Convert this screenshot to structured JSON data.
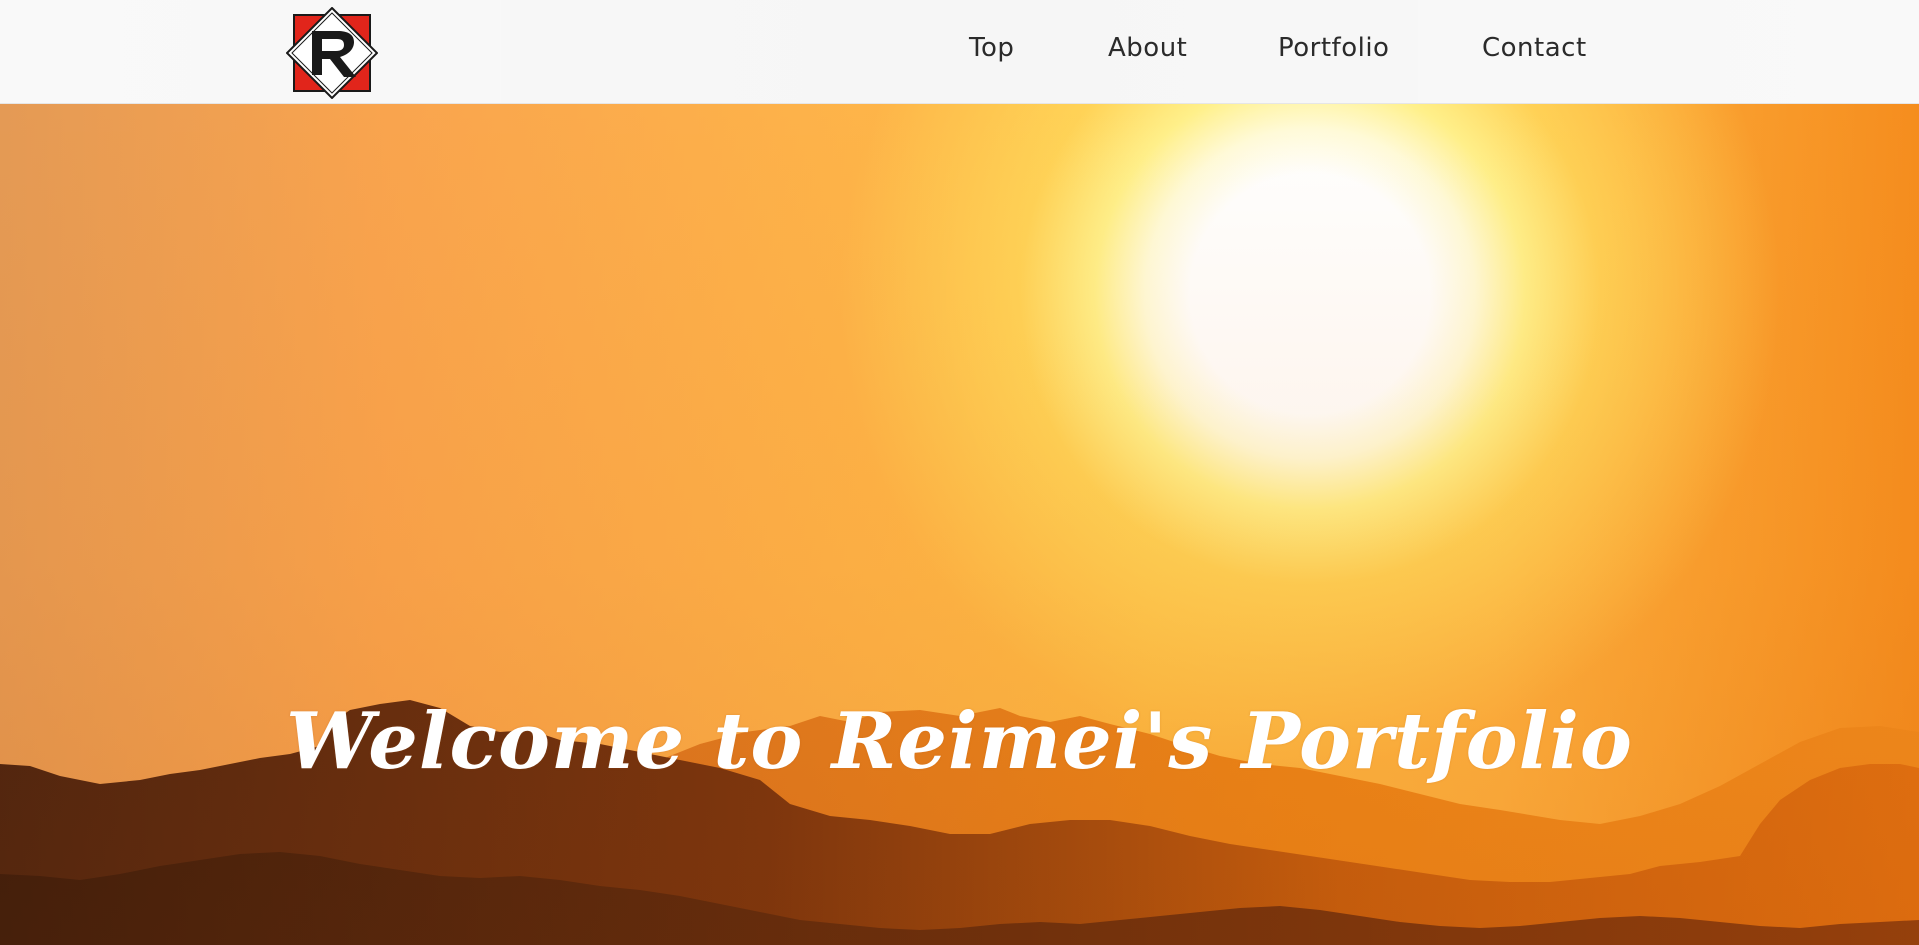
{
  "header": {
    "logo": {
      "icon": "r-diamond-logo-icon",
      "letter": "R",
      "colors": {
        "square": "#e1251b",
        "diamond": "#ffffff",
        "letter": "#1a1a1a"
      }
    },
    "nav": [
      {
        "id": "top",
        "label": "Top"
      },
      {
        "id": "about",
        "label": "About"
      },
      {
        "id": "portfolio",
        "label": "Portfolio"
      },
      {
        "id": "contact",
        "label": "Contact"
      }
    ]
  },
  "hero": {
    "title": "Welcome to Reimei's Portfolio",
    "image": "sunset-over-mountains",
    "colors": {
      "sky_left": "#e49a55",
      "sky_mid": "#ffbd45",
      "sky_right": "#f58d1e",
      "sun": "#ffffff",
      "mountain_far": "#e8780f",
      "mountain_mid": "#b5520f",
      "mountain_near": "#3a1a0d"
    }
  }
}
